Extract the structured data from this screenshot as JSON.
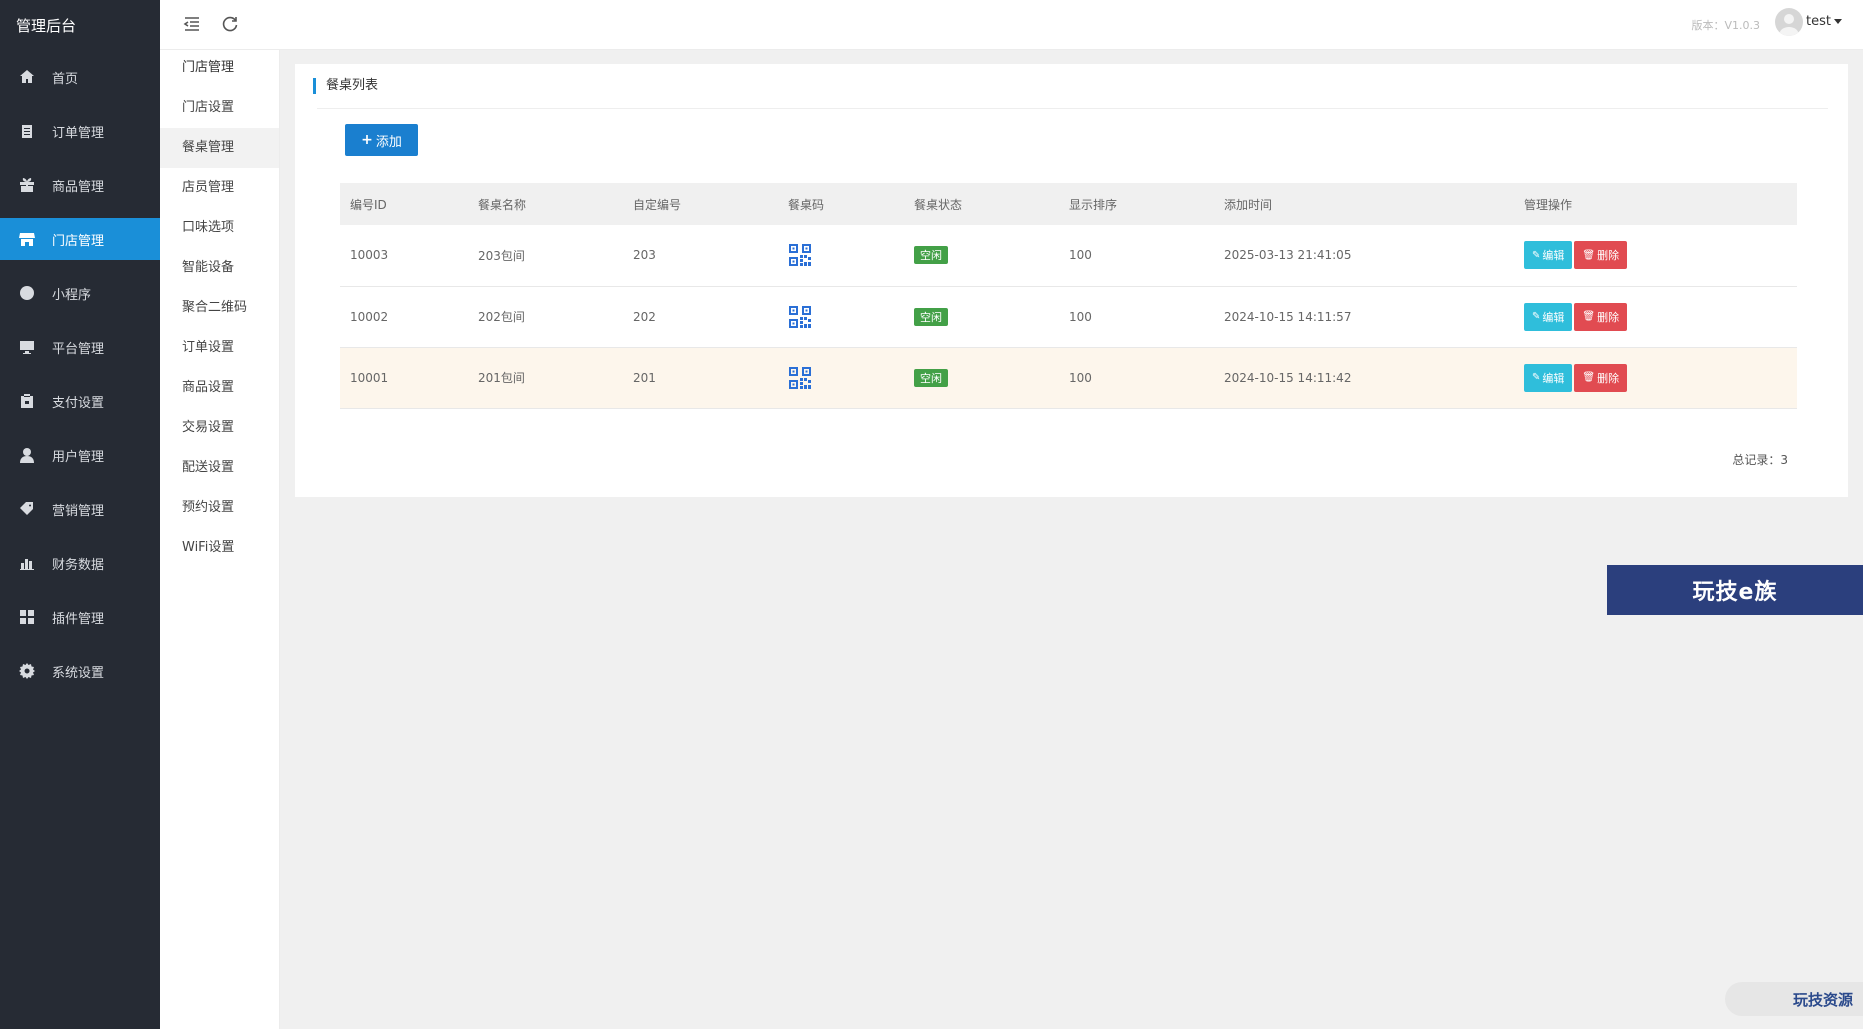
{
  "brand": "管理后台",
  "nav": [
    {
      "label": "首页",
      "icon": "home-icon"
    },
    {
      "label": "订单管理",
      "icon": "clipboard-icon"
    },
    {
      "label": "商品管理",
      "icon": "gift-icon"
    },
    {
      "label": "门店管理",
      "icon": "store-icon"
    },
    {
      "label": "小程序",
      "icon": "mini-program-icon"
    },
    {
      "label": "平台管理",
      "icon": "monitor-icon"
    },
    {
      "label": "支付设置",
      "icon": "wallet-icon"
    },
    {
      "label": "用户管理",
      "icon": "user-icon"
    },
    {
      "label": "营销管理",
      "icon": "tags-icon"
    },
    {
      "label": "财务数据",
      "icon": "bar-chart-icon"
    },
    {
      "label": "插件管理",
      "icon": "puzzle-icon"
    },
    {
      "label": "系统设置",
      "icon": "gear-icon"
    }
  ],
  "subnav": {
    "title": "门店管理",
    "items": [
      "门店设置",
      "餐桌管理",
      "店员管理",
      "口味选项",
      "智能设备",
      "聚合二维码",
      "订单设置",
      "商品设置",
      "交易设置",
      "配送设置",
      "预约设置",
      "WiFi设置"
    ]
  },
  "header": {
    "version": "版本：V1.0.3",
    "user": "test"
  },
  "panel": {
    "title": "餐桌列表",
    "add_label": "添加",
    "edit_label": "编辑",
    "delete_label": "删除",
    "total_label": "总记录：3"
  },
  "table": {
    "columns": [
      "编号ID",
      "餐桌名称",
      "自定编号",
      "餐桌码",
      "餐桌状态",
      "显示排序",
      "添加时间",
      "管理操作"
    ],
    "rows": [
      {
        "id": "10003",
        "name": "203包间",
        "code": "203",
        "status": "空闲",
        "sort": "100",
        "time": "2025-03-13 21:41:05"
      },
      {
        "id": "10002",
        "name": "202包间",
        "code": "202",
        "status": "空闲",
        "sort": "100",
        "time": "2024-10-15 14:11:57"
      },
      {
        "id": "10001",
        "name": "201包间",
        "code": "201",
        "status": "空闲",
        "sort": "100",
        "time": "2024-10-15 14:11:42"
      }
    ]
  },
  "banner": "玩技e族",
  "corner": "玩技资源",
  "colors": {
    "accent": "#1a8fd8",
    "sidebar": "#262b34",
    "status_green": "#43a047",
    "edit": "#2fbedb",
    "delete": "#e14b51"
  }
}
